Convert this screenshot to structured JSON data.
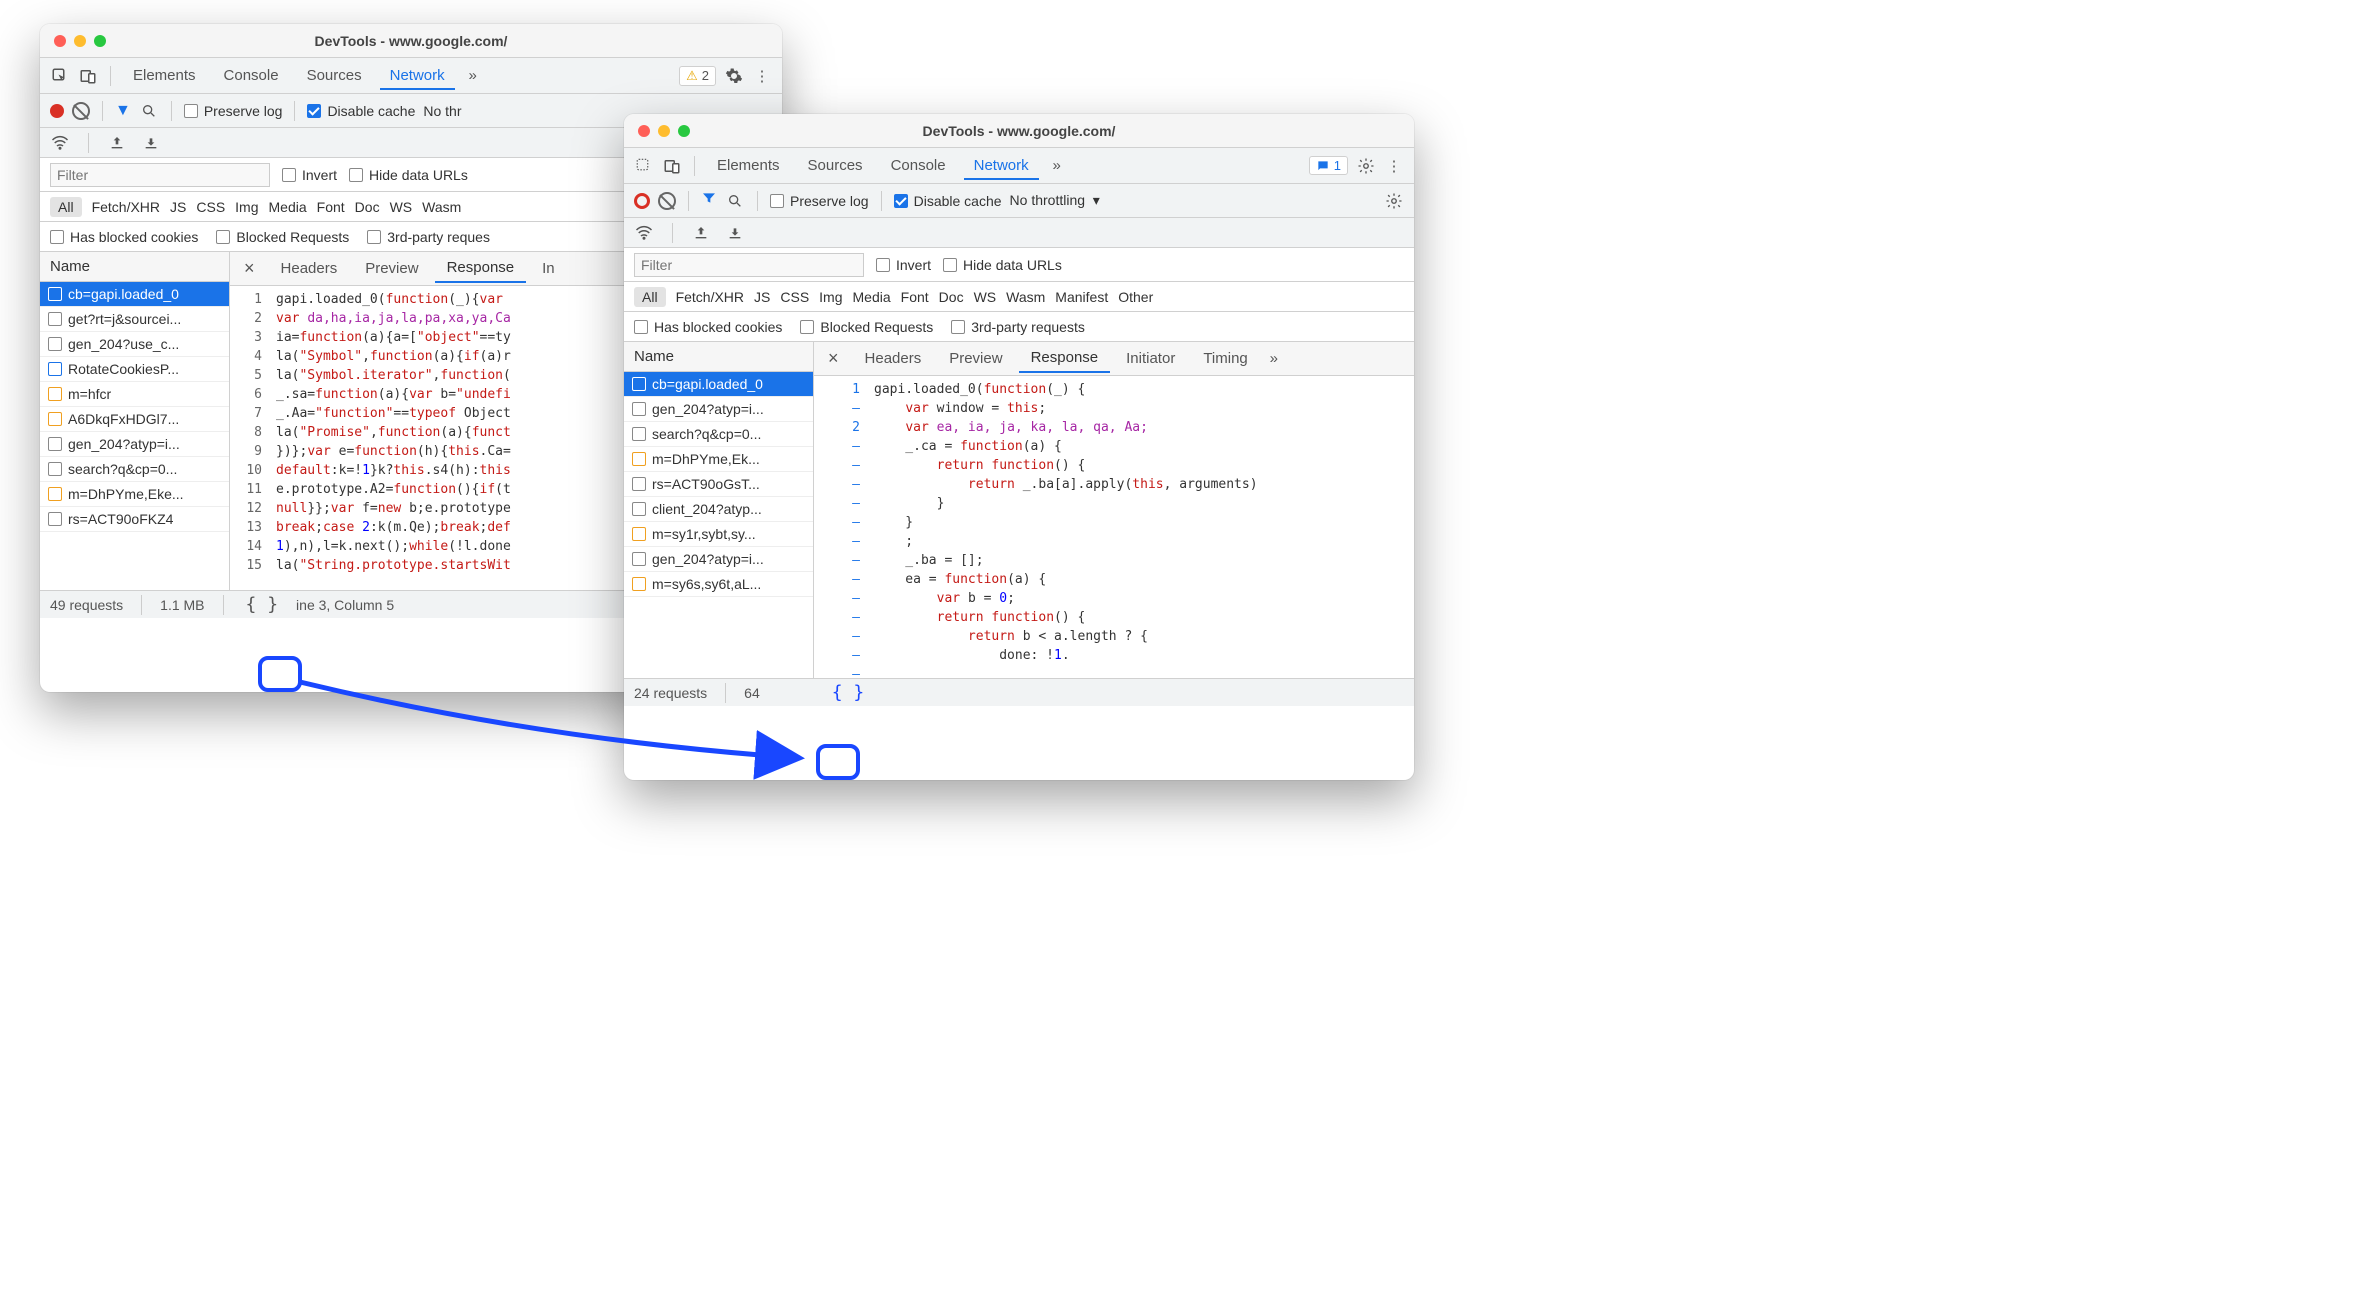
{
  "windows": {
    "win1": {
      "title": "DevTools - www.google.com/",
      "tabs": [
        "Elements",
        "Console",
        "Sources",
        "Network"
      ],
      "active_tab": "Network",
      "warn_count": "2",
      "preserve_log": "Preserve log",
      "disable_cache": "Disable cache",
      "throttling": "No thr",
      "filter_placeholder": "Filter",
      "invert": "Invert",
      "hide_urls": "Hide data URLs",
      "types": [
        "All",
        "Fetch/XHR",
        "JS",
        "CSS",
        "Img",
        "Media",
        "Font",
        "Doc",
        "WS",
        "Wasm"
      ],
      "blocked_cookies": "Has blocked cookies",
      "blocked_req": "Blocked Requests",
      "third_party": "3rd-party reques",
      "name_header": "Name",
      "requests": [
        {
          "label": "cb=gapi.loaded_0",
          "kind": "js",
          "sel": true
        },
        {
          "label": "get?rt=j&sourcei...",
          "kind": "doc"
        },
        {
          "label": "gen_204?use_c...",
          "kind": "doc"
        },
        {
          "label": "RotateCookiesP...",
          "kind": "blue"
        },
        {
          "label": "m=hfcr",
          "kind": "js"
        },
        {
          "label": "A6DkqFxHDGl7...",
          "kind": "js"
        },
        {
          "label": "gen_204?atyp=i...",
          "kind": "doc"
        },
        {
          "label": "search?q&cp=0...",
          "kind": "doc"
        },
        {
          "label": "m=DhPYme,Eke...",
          "kind": "js"
        },
        {
          "label": "rs=ACT90oFKZ4",
          "kind": "doc"
        }
      ],
      "resp_tabs": [
        "Headers",
        "Preview",
        "Response",
        "In"
      ],
      "resp_active": "Response",
      "gutter": " 1\n 2\n 3\n 4\n 5\n 6\n 7\n 8\n 9\n10\n11\n12\n13\n14\n15",
      "code_lines": [
        [
          {
            "t": "gapi.loaded_0("
          },
          {
            "t": "function",
            "c": "darkred"
          },
          {
            "t": "(_){"
          },
          {
            "t": "var ",
            "c": "darkred"
          }
        ],
        [
          {
            "t": "var ",
            "c": "darkred"
          },
          {
            "t": "da,ha,ia,ja,la,pa,xa,ya,Ca",
            "c": "purple"
          }
        ],
        [
          {
            "t": "ia="
          },
          {
            "t": "function",
            "c": "darkred"
          },
          {
            "t": "(a){a=["
          },
          {
            "t": "\"object\"",
            "c": "darkred"
          },
          {
            "t": "==ty"
          }
        ],
        [
          {
            "t": "la("
          },
          {
            "t": "\"Symbol\"",
            "c": "darkred"
          },
          {
            "t": ","
          },
          {
            "t": "function",
            "c": "darkred"
          },
          {
            "t": "(a){"
          },
          {
            "t": "if",
            "c": "darkred"
          },
          {
            "t": "(a)r"
          }
        ],
        [
          {
            "t": "la("
          },
          {
            "t": "\"Symbol.iterator\"",
            "c": "darkred"
          },
          {
            "t": ","
          },
          {
            "t": "function",
            "c": "darkred"
          },
          {
            "t": "("
          }
        ],
        [
          {
            "t": "_.sa="
          },
          {
            "t": "function",
            "c": "darkred"
          },
          {
            "t": "(a){"
          },
          {
            "t": "var ",
            "c": "darkred"
          },
          {
            "t": "b="
          },
          {
            "t": "\"undefi",
            "c": "darkred"
          }
        ],
        [
          {
            "t": "_.Aa="
          },
          {
            "t": "\"function\"",
            "c": "darkred"
          },
          {
            "t": "=="
          },
          {
            "t": "typeof ",
            "c": "darkred"
          },
          {
            "t": "Object"
          }
        ],
        [
          {
            "t": "la("
          },
          {
            "t": "\"Promise\"",
            "c": "darkred"
          },
          {
            "t": ","
          },
          {
            "t": "function",
            "c": "darkred"
          },
          {
            "t": "(a){"
          },
          {
            "t": "funct",
            "c": "darkred"
          }
        ],
        [
          {
            "t": "})};"
          },
          {
            "t": "var ",
            "c": "darkred"
          },
          {
            "t": "e="
          },
          {
            "t": "function",
            "c": "darkred"
          },
          {
            "t": "(h){"
          },
          {
            "t": "this",
            "c": "darkred"
          },
          {
            "t": ".Ca="
          }
        ],
        [
          {
            "t": "default",
            "c": "darkred"
          },
          {
            "t": ":k=!"
          },
          {
            "t": "1",
            "c": "blue"
          },
          {
            "t": "}k?"
          },
          {
            "t": "this",
            "c": "darkred"
          },
          {
            "t": ".s4(h):"
          },
          {
            "t": "this",
            "c": "darkred"
          }
        ],
        [
          {
            "t": "e.prototype.A2="
          },
          {
            "t": "function",
            "c": "darkred"
          },
          {
            "t": "(){"
          },
          {
            "t": "if",
            "c": "darkred"
          },
          {
            "t": "(t"
          }
        ],
        [
          {
            "t": "null",
            "c": "darkred"
          },
          {
            "t": "}};"
          },
          {
            "t": "var ",
            "c": "darkred"
          },
          {
            "t": "f="
          },
          {
            "t": "new ",
            "c": "darkred"
          },
          {
            "t": "b;e.prototype"
          }
        ],
        [
          {
            "t": "break",
            "c": "darkred"
          },
          {
            "t": ";"
          },
          {
            "t": "case ",
            "c": "darkred"
          },
          {
            "t": "2",
            "c": "blue"
          },
          {
            "t": ":k(m.Qe);"
          },
          {
            "t": "break",
            "c": "darkred"
          },
          {
            "t": ";"
          },
          {
            "t": "def",
            "c": "darkred"
          }
        ],
        [
          {
            "t": "1",
            "c": "blue"
          },
          {
            "t": "),n),l=k.next();"
          },
          {
            "t": "while",
            "c": "darkred"
          },
          {
            "t": "(!l.done"
          }
        ],
        [
          {
            "t": "la("
          },
          {
            "t": "\"String.prototype.startsWit",
            "c": "darkred"
          }
        ]
      ],
      "status_requests": "49 requests",
      "status_size": "1.1 MB",
      "cursor": "ine 3, Column 5"
    },
    "win2": {
      "title": "DevTools - www.google.com/",
      "tabs": [
        "Elements",
        "Sources",
        "Console",
        "Network"
      ],
      "active_tab": "Network",
      "msg_count": "1",
      "preserve_log": "Preserve log",
      "disable_cache": "Disable cache",
      "throttling": "No throttling",
      "filter_placeholder": "Filter",
      "invert": "Invert",
      "hide_urls": "Hide data URLs",
      "types": [
        "All",
        "Fetch/XHR",
        "JS",
        "CSS",
        "Img",
        "Media",
        "Font",
        "Doc",
        "WS",
        "Wasm",
        "Manifest",
        "Other"
      ],
      "blocked_cookies": "Has blocked cookies",
      "blocked_req": "Blocked Requests",
      "third_party": "3rd-party requests",
      "name_header": "Name",
      "requests": [
        {
          "label": "cb=gapi.loaded_0",
          "kind": "js",
          "sel": true
        },
        {
          "label": "gen_204?atyp=i...",
          "kind": "doc"
        },
        {
          "label": "search?q&cp=0...",
          "kind": "doc"
        },
        {
          "label": "m=DhPYme,Ek...",
          "kind": "js"
        },
        {
          "label": "rs=ACT90oGsT...",
          "kind": "doc"
        },
        {
          "label": "client_204?atyp...",
          "kind": "doc"
        },
        {
          "label": "m=sy1r,sybt,sy...",
          "kind": "js"
        },
        {
          "label": "gen_204?atyp=i...",
          "kind": "doc"
        },
        {
          "label": "m=sy6s,sy6t,aL...",
          "kind": "js"
        }
      ],
      "resp_tabs": [
        "Headers",
        "Preview",
        "Response",
        "Initiator",
        "Timing"
      ],
      "resp_active": "Response",
      "gutter": "1\n–\n2\n–\n–\n–\n–\n–\n–\n–\n–\n–\n–\n–\n–\n–",
      "code_lines": [
        [
          {
            "t": "gapi.loaded_0("
          },
          {
            "t": "function",
            "c": "darkred"
          },
          {
            "t": "(_) {"
          }
        ],
        [
          {
            "t": "    "
          },
          {
            "t": "var ",
            "c": "darkred"
          },
          {
            "t": "window = "
          },
          {
            "t": "this",
            "c": "darkred"
          },
          {
            "t": ";"
          }
        ],
        [
          {
            "t": "    "
          },
          {
            "t": "var ",
            "c": "darkred"
          },
          {
            "t": "ea, ia, ja, ka, la, qa, Aa;",
            "c": "purple"
          }
        ],
        [
          {
            "t": "    _.ca = "
          },
          {
            "t": "function",
            "c": "darkred"
          },
          {
            "t": "(a) {"
          }
        ],
        [
          {
            "t": "        "
          },
          {
            "t": "return function",
            "c": "darkred"
          },
          {
            "t": "() {"
          }
        ],
        [
          {
            "t": "            "
          },
          {
            "t": "return ",
            "c": "darkred"
          },
          {
            "t": "_.ba[a].apply("
          },
          {
            "t": "this",
            "c": "darkred"
          },
          {
            "t": ", arguments)"
          }
        ],
        [
          {
            "t": "        }"
          }
        ],
        [
          {
            "t": "    }"
          }
        ],
        [
          {
            "t": "    ;"
          }
        ],
        [
          {
            "t": "    _.ba = [];"
          }
        ],
        [
          {
            "t": "    ea = "
          },
          {
            "t": "function",
            "c": "darkred"
          },
          {
            "t": "(a) {"
          }
        ],
        [
          {
            "t": "        "
          },
          {
            "t": "var ",
            "c": "darkred"
          },
          {
            "t": "b = "
          },
          {
            "t": "0",
            "c": "blue"
          },
          {
            "t": ";"
          }
        ],
        [
          {
            "t": "        "
          },
          {
            "t": "return function",
            "c": "darkred"
          },
          {
            "t": "() {"
          }
        ],
        [
          {
            "t": "            "
          },
          {
            "t": "return ",
            "c": "darkred"
          },
          {
            "t": "b < a.length ? {"
          }
        ],
        [
          {
            "t": "                done: !"
          },
          {
            "t": "1",
            "c": "blue"
          },
          {
            "t": "."
          }
        ]
      ],
      "status_requests": "24 requests",
      "status_size": "64"
    }
  }
}
